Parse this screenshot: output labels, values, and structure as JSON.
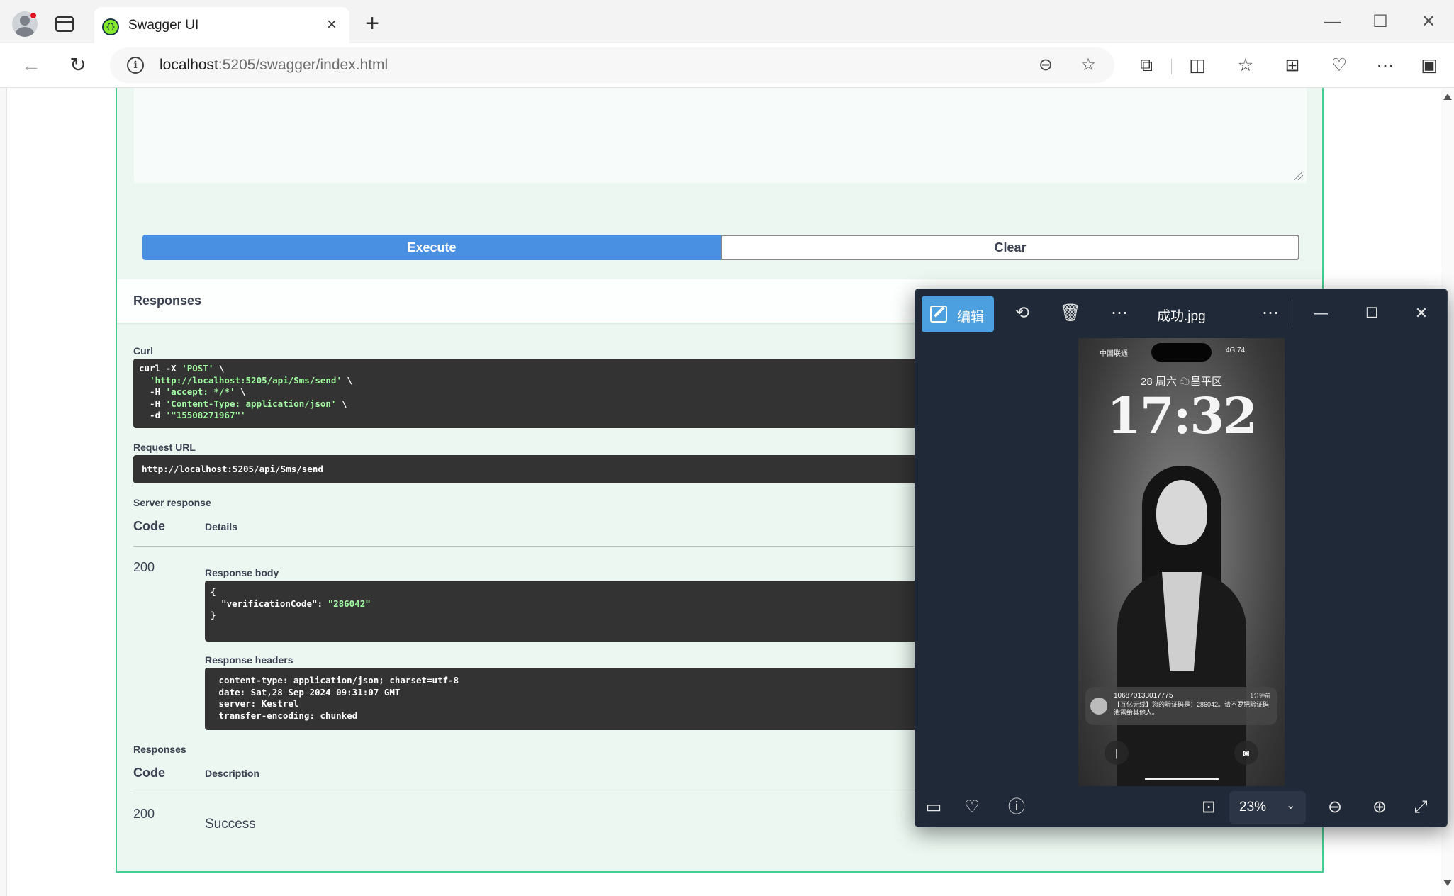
{
  "browser": {
    "tab_title": "Swagger UI",
    "url_host": "localhost",
    "url_rest": ":5205/swagger/index.html"
  },
  "swagger": {
    "execute_label": "Execute",
    "clear_label": "Clear",
    "responses_title": "Responses",
    "curl_label": "Curl",
    "curl_lines": [
      [
        "curl -X ",
        "'POST'",
        " \\"
      ],
      [
        "  ",
        "'http://localhost:5205/api/Sms/send'",
        " \\"
      ],
      [
        "  -H ",
        "'accept: */*'",
        " \\"
      ],
      [
        "  -H ",
        "'Content-Type: application/json'",
        " \\"
      ],
      [
        "  -d ",
        "'\"15508271967\"'",
        ""
      ]
    ],
    "request_url_label": "Request URL",
    "request_url": "http://localhost:5205/api/Sms/send",
    "server_response_label": "Server response",
    "code_header": "Code",
    "details_header": "Details",
    "status_code": "200",
    "response_body_label": "Response body",
    "response_body": {
      "open": "{",
      "key": "  \"verificationCode\": ",
      "value": "\"286042\"",
      "close": "}"
    },
    "response_headers_label": "Response headers",
    "response_headers": " content-type: application/json; charset=utf-8\n date: Sat,28 Sep 2024 09:31:07 GMT\n server: Kestrel\n transfer-encoding: chunked",
    "responses_label": "Responses",
    "description_header": "Description",
    "doc_code": "200",
    "doc_description": "Success"
  },
  "viewer": {
    "edit_label": "编辑",
    "file_name": "成功.jpg",
    "zoom": "23%",
    "phone": {
      "carrier": "中国联通",
      "status": "4G 74",
      "date": "28 周六 ☁昌平区",
      "time": "17:32",
      "notif_from": "106870133017775",
      "notif_when": "1分钟前",
      "notif_text": "【互亿无线】您的验证码是：286042。请不要把验证码泄露给其他人。"
    }
  }
}
